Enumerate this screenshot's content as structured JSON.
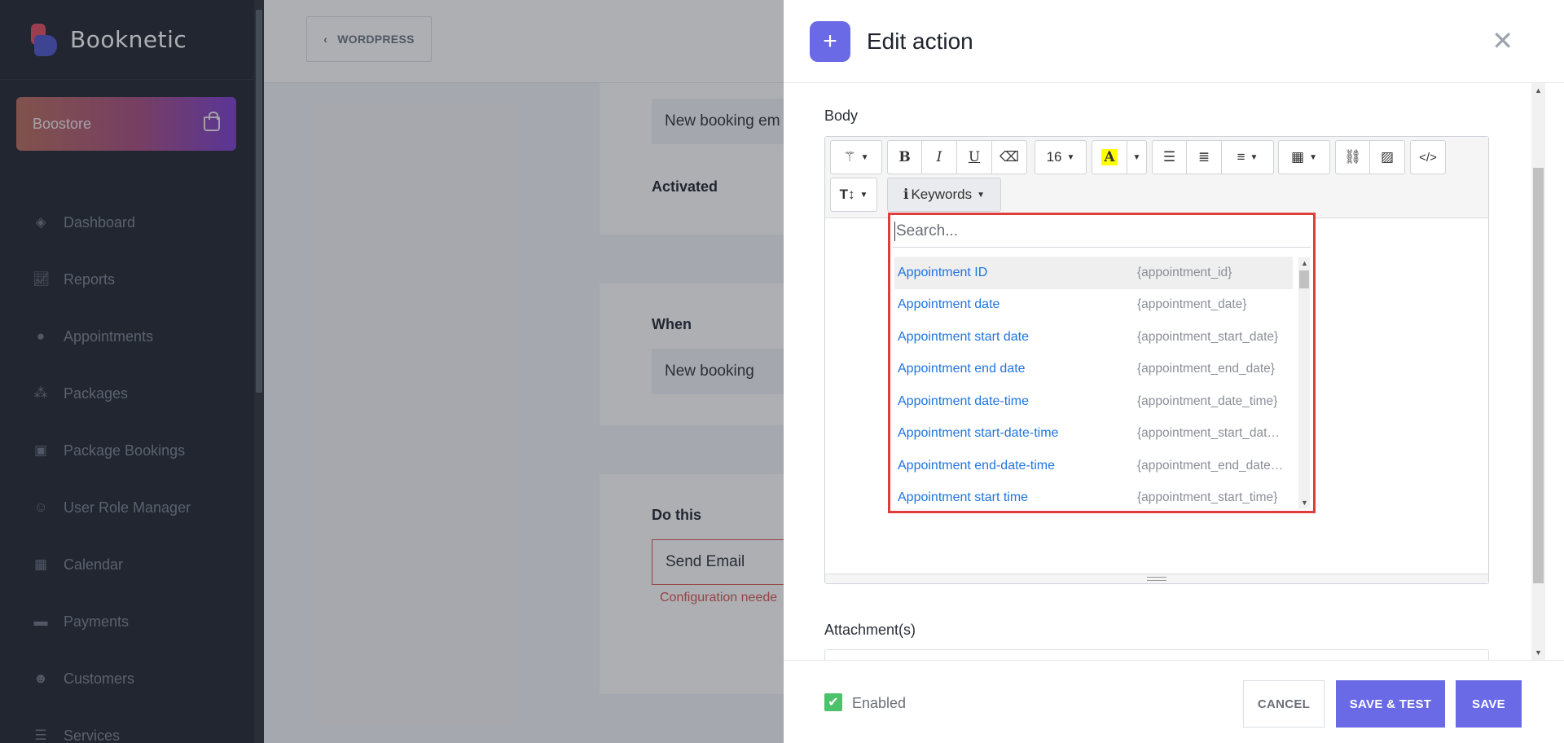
{
  "sidebar": {
    "brand": "Booknetic",
    "boostore": "Boostore",
    "items": [
      {
        "label": "Dashboard",
        "icon": "dashboard-icon"
      },
      {
        "label": "Reports",
        "icon": "chart-icon"
      },
      {
        "label": "Appointments",
        "icon": "clock-icon"
      },
      {
        "label": "Packages",
        "icon": "cubes-icon"
      },
      {
        "label": "Package Bookings",
        "icon": "boxes-icon"
      },
      {
        "label": "User Role Manager",
        "icon": "user-plus-icon"
      },
      {
        "label": "Calendar",
        "icon": "calendar-icon"
      },
      {
        "label": "Payments",
        "icon": "wallet-icon"
      },
      {
        "label": "Customers",
        "icon": "users-icon"
      },
      {
        "label": "Services",
        "icon": "list-icon"
      }
    ]
  },
  "main": {
    "wordpress_button": "WORDPRESS",
    "name_value": "New booking em",
    "activated_label": "Activated",
    "when_label": "When",
    "when_value": "New booking",
    "do_this_label": "Do this",
    "do_this_value": "Send Email",
    "config_note": "Configuration neede"
  },
  "panel": {
    "title": "Edit action",
    "body_label": "Body",
    "toolbar": {
      "font_size": "16",
      "keywords_label": "Keywords"
    },
    "keywords": {
      "search_placeholder": "Search...",
      "items": [
        {
          "label": "Appointment ID",
          "value": "{appointment_id}"
        },
        {
          "label": "Appointment date",
          "value": "{appointment_date}"
        },
        {
          "label": "Appointment start date",
          "value": "{appointment_start_date}"
        },
        {
          "label": "Appointment end date",
          "value": "{appointment_end_date}"
        },
        {
          "label": "Appointment date-time",
          "value": "{appointment_date_time}"
        },
        {
          "label": "Appointment start-date-time",
          "value": "{appointment_start_date_time}"
        },
        {
          "label": "Appointment end-date-time",
          "value": "{appointment_end_date_time}"
        },
        {
          "label": "Appointment start time",
          "value": "{appointment_start_time}"
        }
      ]
    },
    "attachments_label": "Attachment(s)",
    "footer": {
      "enabled_label": "Enabled",
      "cancel": "CANCEL",
      "save_test": "SAVE & TEST",
      "save": "SAVE"
    }
  },
  "colors": {
    "accent": "#6a6ae6",
    "sidebar_bg": "#1d222c",
    "highlight_border": "#e03c3c",
    "keyword_link": "#1f75e0",
    "enabled_check": "#4cc26b"
  }
}
